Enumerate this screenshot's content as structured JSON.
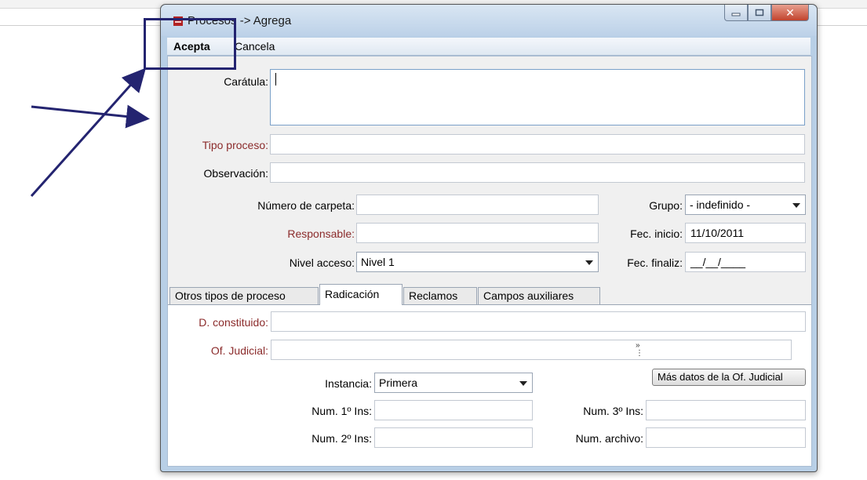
{
  "window": {
    "title": "Procesos -> Agrega",
    "icons": [
      "app-icon",
      "minimize-icon",
      "maximize-icon",
      "close-icon"
    ]
  },
  "menu": {
    "accept": "Acepta",
    "cancel": "Cancela"
  },
  "form": {
    "caratula_label": "Carátula:",
    "tipo_proceso_label": "Tipo proceso:",
    "observacion_label": "Observación:",
    "numero_carpeta_label": "Número de carpeta:",
    "responsable_label": "Responsable:",
    "nivel_acceso_label": "Nivel acceso:",
    "nivel_acceso_value": "Nivel 1",
    "grupo_label": "Grupo:",
    "grupo_value": "- indefinido -",
    "fec_inicio_label": "Fec. inicio:",
    "fec_inicio_value": "11/10/2011",
    "fec_finaliz_label": "Fec. finaliz:",
    "fec_finaliz_value": "__/__/____"
  },
  "tabs": [
    {
      "label": "Otros tipos de proceso",
      "active": false
    },
    {
      "label": "Radicación",
      "active": true
    },
    {
      "label": "Reclamos",
      "active": false
    },
    {
      "label": "Campos auxiliares",
      "active": false
    }
  ],
  "radicacion": {
    "d_constituido_label": "D. constituido:",
    "of_judicial_label": "Of. Judicial:",
    "instancia_label": "Instancia:",
    "instancia_value": "Primera",
    "mas_datos_button": "Más datos de la Of. Judicial",
    "num1_label": "Num. 1º Ins:",
    "num2_label": "Num. 2º Ins:",
    "num3_label": "Num. 3º Ins:",
    "num_archivo_label": "Num. archivo:"
  },
  "colors": {
    "required_label": "#8b2b2b",
    "annotation": "#242470",
    "window_frame": "#b8cfe6"
  }
}
